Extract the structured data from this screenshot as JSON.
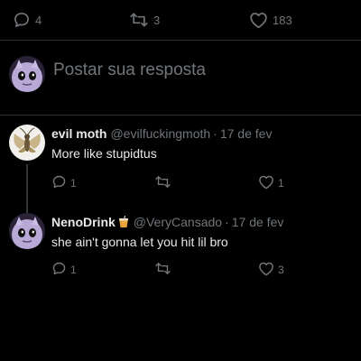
{
  "post_actions": {
    "reply_count": "4",
    "repost_count": "3",
    "like_count": "183"
  },
  "compose": {
    "placeholder": "Postar sua resposta"
  },
  "replies": [
    {
      "name": "evil moth",
      "handle": "@evilfuckingmoth",
      "separator": "·",
      "time": "17 de fev",
      "text": "More like stupidtus",
      "reply_count": "1",
      "repost_count": "",
      "like_count": "1",
      "avatar": "moth-avatar"
    },
    {
      "name": "NenoDrink",
      "badge": "drink-emoji-icon",
      "handle": "@VeryCansado",
      "separator": "·",
      "time": "17 de fev",
      "text": "she ain't gonna let you hit lil bro",
      "reply_count": "1",
      "repost_count": "",
      "like_count": "3",
      "avatar": "pale-creature-avatar"
    }
  ],
  "colors": {
    "background": "#000000",
    "text_primary": "#e7e9ea",
    "text_secondary": "#71767b",
    "divider": "#2f3336",
    "thread_line": "#333639"
  }
}
